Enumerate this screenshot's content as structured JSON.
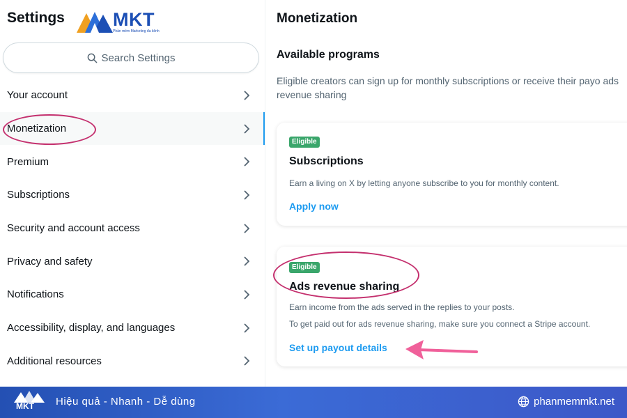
{
  "left": {
    "title": "Settings",
    "search_placeholder": "Search Settings",
    "items": [
      {
        "label": "Your account"
      },
      {
        "label": "Monetization"
      },
      {
        "label": "Premium"
      },
      {
        "label": "Subscriptions"
      },
      {
        "label": "Security and account access"
      },
      {
        "label": "Privacy and safety"
      },
      {
        "label": "Notifications"
      },
      {
        "label": "Accessibility, display, and languages"
      },
      {
        "label": "Additional resources"
      }
    ],
    "active_item": "Monetization"
  },
  "logo": {
    "text": "MKT",
    "subtext": "Phần mềm Marketing đa kênh"
  },
  "main": {
    "title": "Monetization",
    "section_title": "Available programs",
    "section_desc": "Eligible creators can sign up for monthly subscriptions or receive their payo ads revenue sharing",
    "cards": [
      {
        "badge": "Eligible",
        "title": "Subscriptions",
        "lines": [
          "Earn a living on X by letting anyone subscribe to you for monthly content."
        ],
        "link": "Apply now"
      },
      {
        "badge": "Eligible",
        "title": "Ads revenue sharing",
        "lines": [
          "Earn income from the ads served in the replies to your posts.",
          "To get paid out for ads revenue sharing, make sure you connect a Stripe account."
        ],
        "link": "Set up payout details"
      }
    ]
  },
  "footer": {
    "logo_text": "MKT",
    "tagline": "Hiệu quả - Nhanh  - Dễ dùng",
    "website": "phanmemmkt.net"
  },
  "colors": {
    "accent": "#1d9bf0",
    "badge_green": "#3aa66b",
    "annotation": "#c4306e",
    "arrow": "#f0609a",
    "footer_blue": "#2450b3"
  },
  "icons": [
    "search-icon",
    "chevron-right-icon",
    "globe-icon",
    "mkt-logo-icon"
  ]
}
